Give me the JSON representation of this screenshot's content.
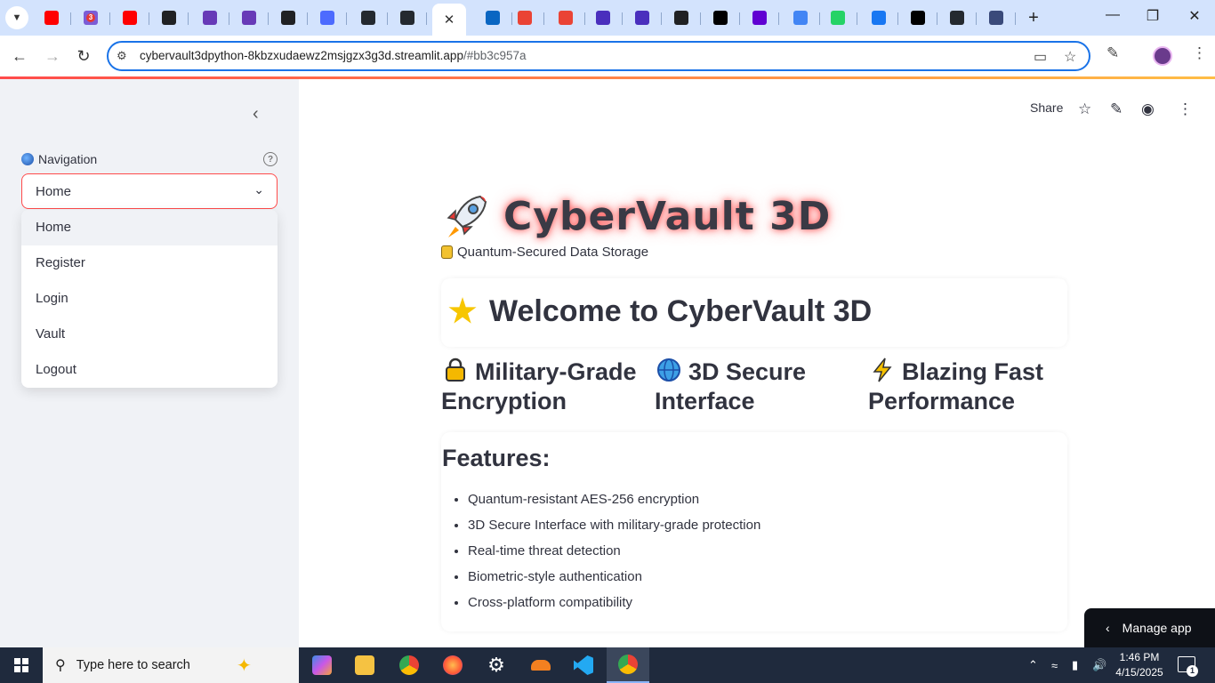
{
  "browser": {
    "url_host": "cybervault3dpython-8kbzxudaewz2msjgzx3g3d.streamlit.app",
    "url_path": "/#bb3c957a",
    "tabs": [
      {
        "icon": "youtube-icon",
        "color": "#ff0000"
      },
      {
        "icon": "copilot-icon",
        "color": "#7b5cd6",
        "badge": "3"
      },
      {
        "icon": "youtube-icon",
        "color": "#ff0000"
      },
      {
        "icon": "chatgpt-icon",
        "color": "#202123"
      },
      {
        "icon": "forms-icon",
        "color": "#673ab7"
      },
      {
        "icon": "forms-icon",
        "color": "#673ab7"
      },
      {
        "icon": "chatgpt-icon",
        "color": "#202123"
      },
      {
        "icon": "deepseek-icon",
        "color": "#4d6bfe"
      },
      {
        "icon": "github-icon",
        "color": "#24292f"
      },
      {
        "icon": "github-icon",
        "color": "#24292f"
      },
      {
        "icon": "active-tab-close-icon",
        "color": "#ffffff",
        "active": true
      },
      {
        "icon": "linkedin-icon",
        "color": "#0a66c2"
      },
      {
        "icon": "gmail-icon",
        "color": "#ea4335"
      },
      {
        "icon": "gmail-icon",
        "color": "#ea4335"
      },
      {
        "icon": "location-icon",
        "color": "#4a2fbd"
      },
      {
        "icon": "location-icon",
        "color": "#4a2fbd"
      },
      {
        "icon": "chatgpt-icon",
        "color": "#202123"
      },
      {
        "icon": "tiktok-icon",
        "color": "#000000"
      },
      {
        "icon": "yahoo-icon",
        "color": "#6001d2"
      },
      {
        "icon": "meet-icon",
        "color": "#4285f4"
      },
      {
        "icon": "whatsapp-icon",
        "color": "#25d366"
      },
      {
        "icon": "facebook-icon",
        "color": "#1877f2"
      },
      {
        "icon": "vercel-icon",
        "color": "#000000"
      },
      {
        "icon": "github-icon",
        "color": "#24292f"
      },
      {
        "icon": "app-icon",
        "color": "#3a4a7a"
      }
    ]
  },
  "sidebar": {
    "nav_label": "Navigation",
    "selected": "Home",
    "options": [
      "Home",
      "Register",
      "Login",
      "Vault",
      "Logout"
    ]
  },
  "header": {
    "share": "Share"
  },
  "hero": {
    "title": "CyberVault 3D",
    "subtitle": "Quantum-Secured Data Storage"
  },
  "welcome": {
    "title": "Welcome to CyberVault 3D"
  },
  "highlights": [
    {
      "line1": "Military-Grade",
      "line2": "Encryption",
      "icon": "lock-icon"
    },
    {
      "line1": "3D Secure",
      "line2": "Interface",
      "icon": "globe-icon"
    },
    {
      "line1": "Blazing Fast",
      "line2": "Performance",
      "icon": "lightning-icon"
    }
  ],
  "features": {
    "heading": "Features:",
    "items": [
      "Quantum-resistant AES-256 encryption",
      "3D Secure Interface with military-grade protection",
      "Real-time threat detection",
      "Biometric-style authentication",
      "Cross-platform compatibility"
    ]
  },
  "manage_app": "Manage app",
  "taskbar": {
    "search_placeholder": "Type here to search",
    "time": "1:46 PM",
    "date": "4/15/2025",
    "notifications": "1"
  },
  "colors": {
    "accent": "#ff4b4b",
    "sidebar_bg": "#f0f2f6",
    "text": "#31333f"
  }
}
